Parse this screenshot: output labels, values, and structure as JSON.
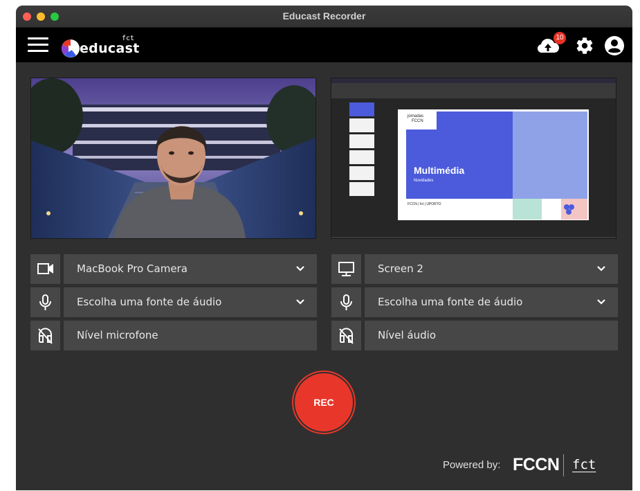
{
  "window": {
    "title": "Educast Recorder"
  },
  "header": {
    "logo_text": "educast",
    "logo_superscript": "fct",
    "upload_badge_count": "10",
    "icons": [
      "menu-icon",
      "cloud-upload-icon",
      "gear-icon",
      "account-icon"
    ]
  },
  "slide": {
    "event_line1": "jornadas",
    "event_line2": "FCCN",
    "title": "Multimédia",
    "subtitle": "Novidades"
  },
  "left_panel": {
    "video_source": "MacBook Pro Camera",
    "audio_source": "Escolha uma fonte de áudio",
    "level_label": "Nível microfone"
  },
  "right_panel": {
    "video_source": "Screen 2",
    "audio_source": "Escolha uma fonte de áudio",
    "level_label": "Nível áudio"
  },
  "record": {
    "label": "REC"
  },
  "footer": {
    "powered_by": "Powered by:",
    "fccn_logo": "FCCN",
    "fct_logo": "fct"
  },
  "colors": {
    "accent_rec": "#e8372a",
    "badge": "#e53224",
    "control_bg": "#474747",
    "window_bg": "#2f2f2f",
    "slide_blue": "#4b5bdc"
  }
}
